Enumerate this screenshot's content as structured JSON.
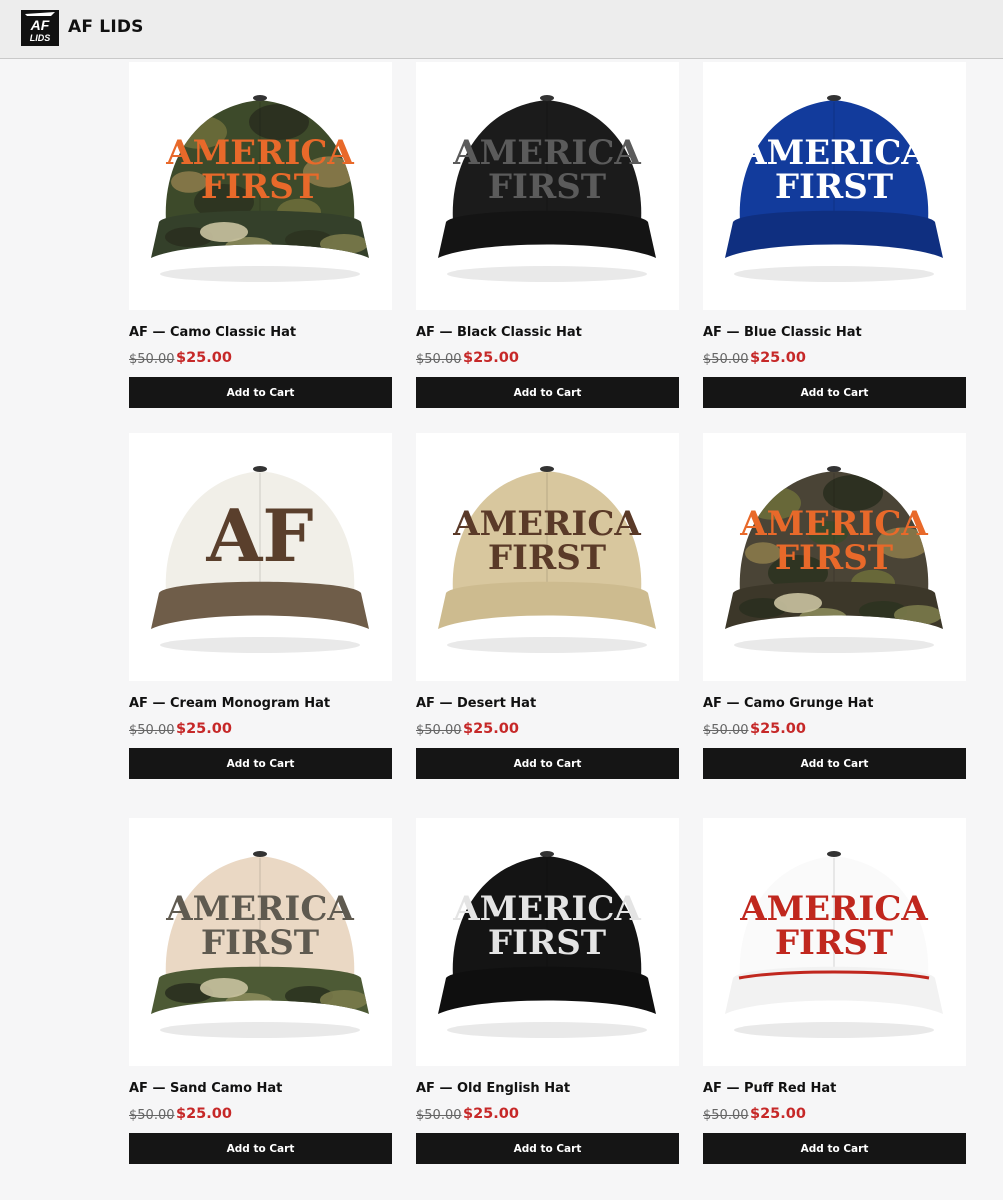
{
  "header": {
    "logo_text_top": "AF",
    "logo_text_bottom": "LIDS",
    "store_name": "AF LIDS"
  },
  "products": [
    {
      "name": "AF — Camo Classic Hat",
      "old_price": "$50.00",
      "price": "$25.00",
      "cart_label": "Add to Cart",
      "art": {
        "lines": [
          "AMERICA",
          "FIRST"
        ],
        "crown": "#3d4a2a",
        "brim": "#34402a",
        "camo": true,
        "text_color": "#e8692a",
        "font": "serif"
      }
    },
    {
      "name": "AF — Black Classic Hat",
      "old_price": "$50.00",
      "price": "$25.00",
      "cart_label": "Add to Cart",
      "art": {
        "lines": [
          "AMERICA",
          "FIRST"
        ],
        "crown": "#1b1b1b",
        "brim": "#141414",
        "text_color": "#5b5b5b",
        "font": "serif"
      }
    },
    {
      "name": "AF — Blue Classic Hat",
      "old_price": "$50.00",
      "price": "$25.00",
      "cart_label": "Add to Cart",
      "art": {
        "lines": [
          "AMERICA",
          "FIRST"
        ],
        "crown": "#123b9c",
        "brim": "#0f2f80",
        "text_color": "#ffffff",
        "font": "serif"
      }
    },
    {
      "name": "AF — Cream Monogram Hat",
      "old_price": "$50.00",
      "price": "$25.00",
      "cart_label": "Add to Cart",
      "art": {
        "lines": [
          "AF"
        ],
        "crown": "#f1efe8",
        "brim": "#6f5d49",
        "text_color": "#5a3f2c",
        "font": "serif"
      }
    },
    {
      "name": "AF — Desert Hat",
      "old_price": "$50.00",
      "price": "$25.00",
      "cart_label": "Add to Cart",
      "art": {
        "lines": [
          "AMERICA",
          "FIRST"
        ],
        "crown": "#d8c79e",
        "brim": "#cdbb8f",
        "text_color": "#5a3a28",
        "font": "serif"
      }
    },
    {
      "name": "AF — Camo Grunge Hat",
      "old_price": "$50.00",
      "price": "$25.00",
      "cart_label": "Add to Cart",
      "art": {
        "lines": [
          "AMERICA",
          "FIRST"
        ],
        "crown": "#4a4436",
        "brim": "#3c3729",
        "camo": true,
        "text_color": "#e8692a",
        "font": "serif"
      }
    },
    {
      "name": "AF — Sand Camo Hat",
      "old_price": "$50.00",
      "price": "$25.00",
      "cart_label": "Add to Cart",
      "art": {
        "lines": [
          "AMERICA",
          "FIRST"
        ],
        "crown": "#ead8c4",
        "brim": "#4d5a35",
        "brim_camo": true,
        "text_color": "#5f5a50",
        "font": "serif"
      }
    },
    {
      "name": "AF — Old English Hat",
      "old_price": "$50.00",
      "price": "$25.00",
      "cart_label": "Add to Cart",
      "art": {
        "lines": [
          "AMERICA",
          "FIRST"
        ],
        "crown": "#141414",
        "brim": "#0f0f0f",
        "text_color": "#e4e4e4",
        "font": "serif"
      }
    },
    {
      "name": "AF — Puff Red Hat",
      "old_price": "$50.00",
      "price": "$25.00",
      "cart_label": "Add to Cart",
      "art": {
        "lines": [
          "AMERICA",
          "FIRST"
        ],
        "crown": "#fafafa",
        "brim": "#f2f2f2",
        "text_color": "#c0271e",
        "font": "serif",
        "rope": "#c0271e"
      }
    }
  ]
}
